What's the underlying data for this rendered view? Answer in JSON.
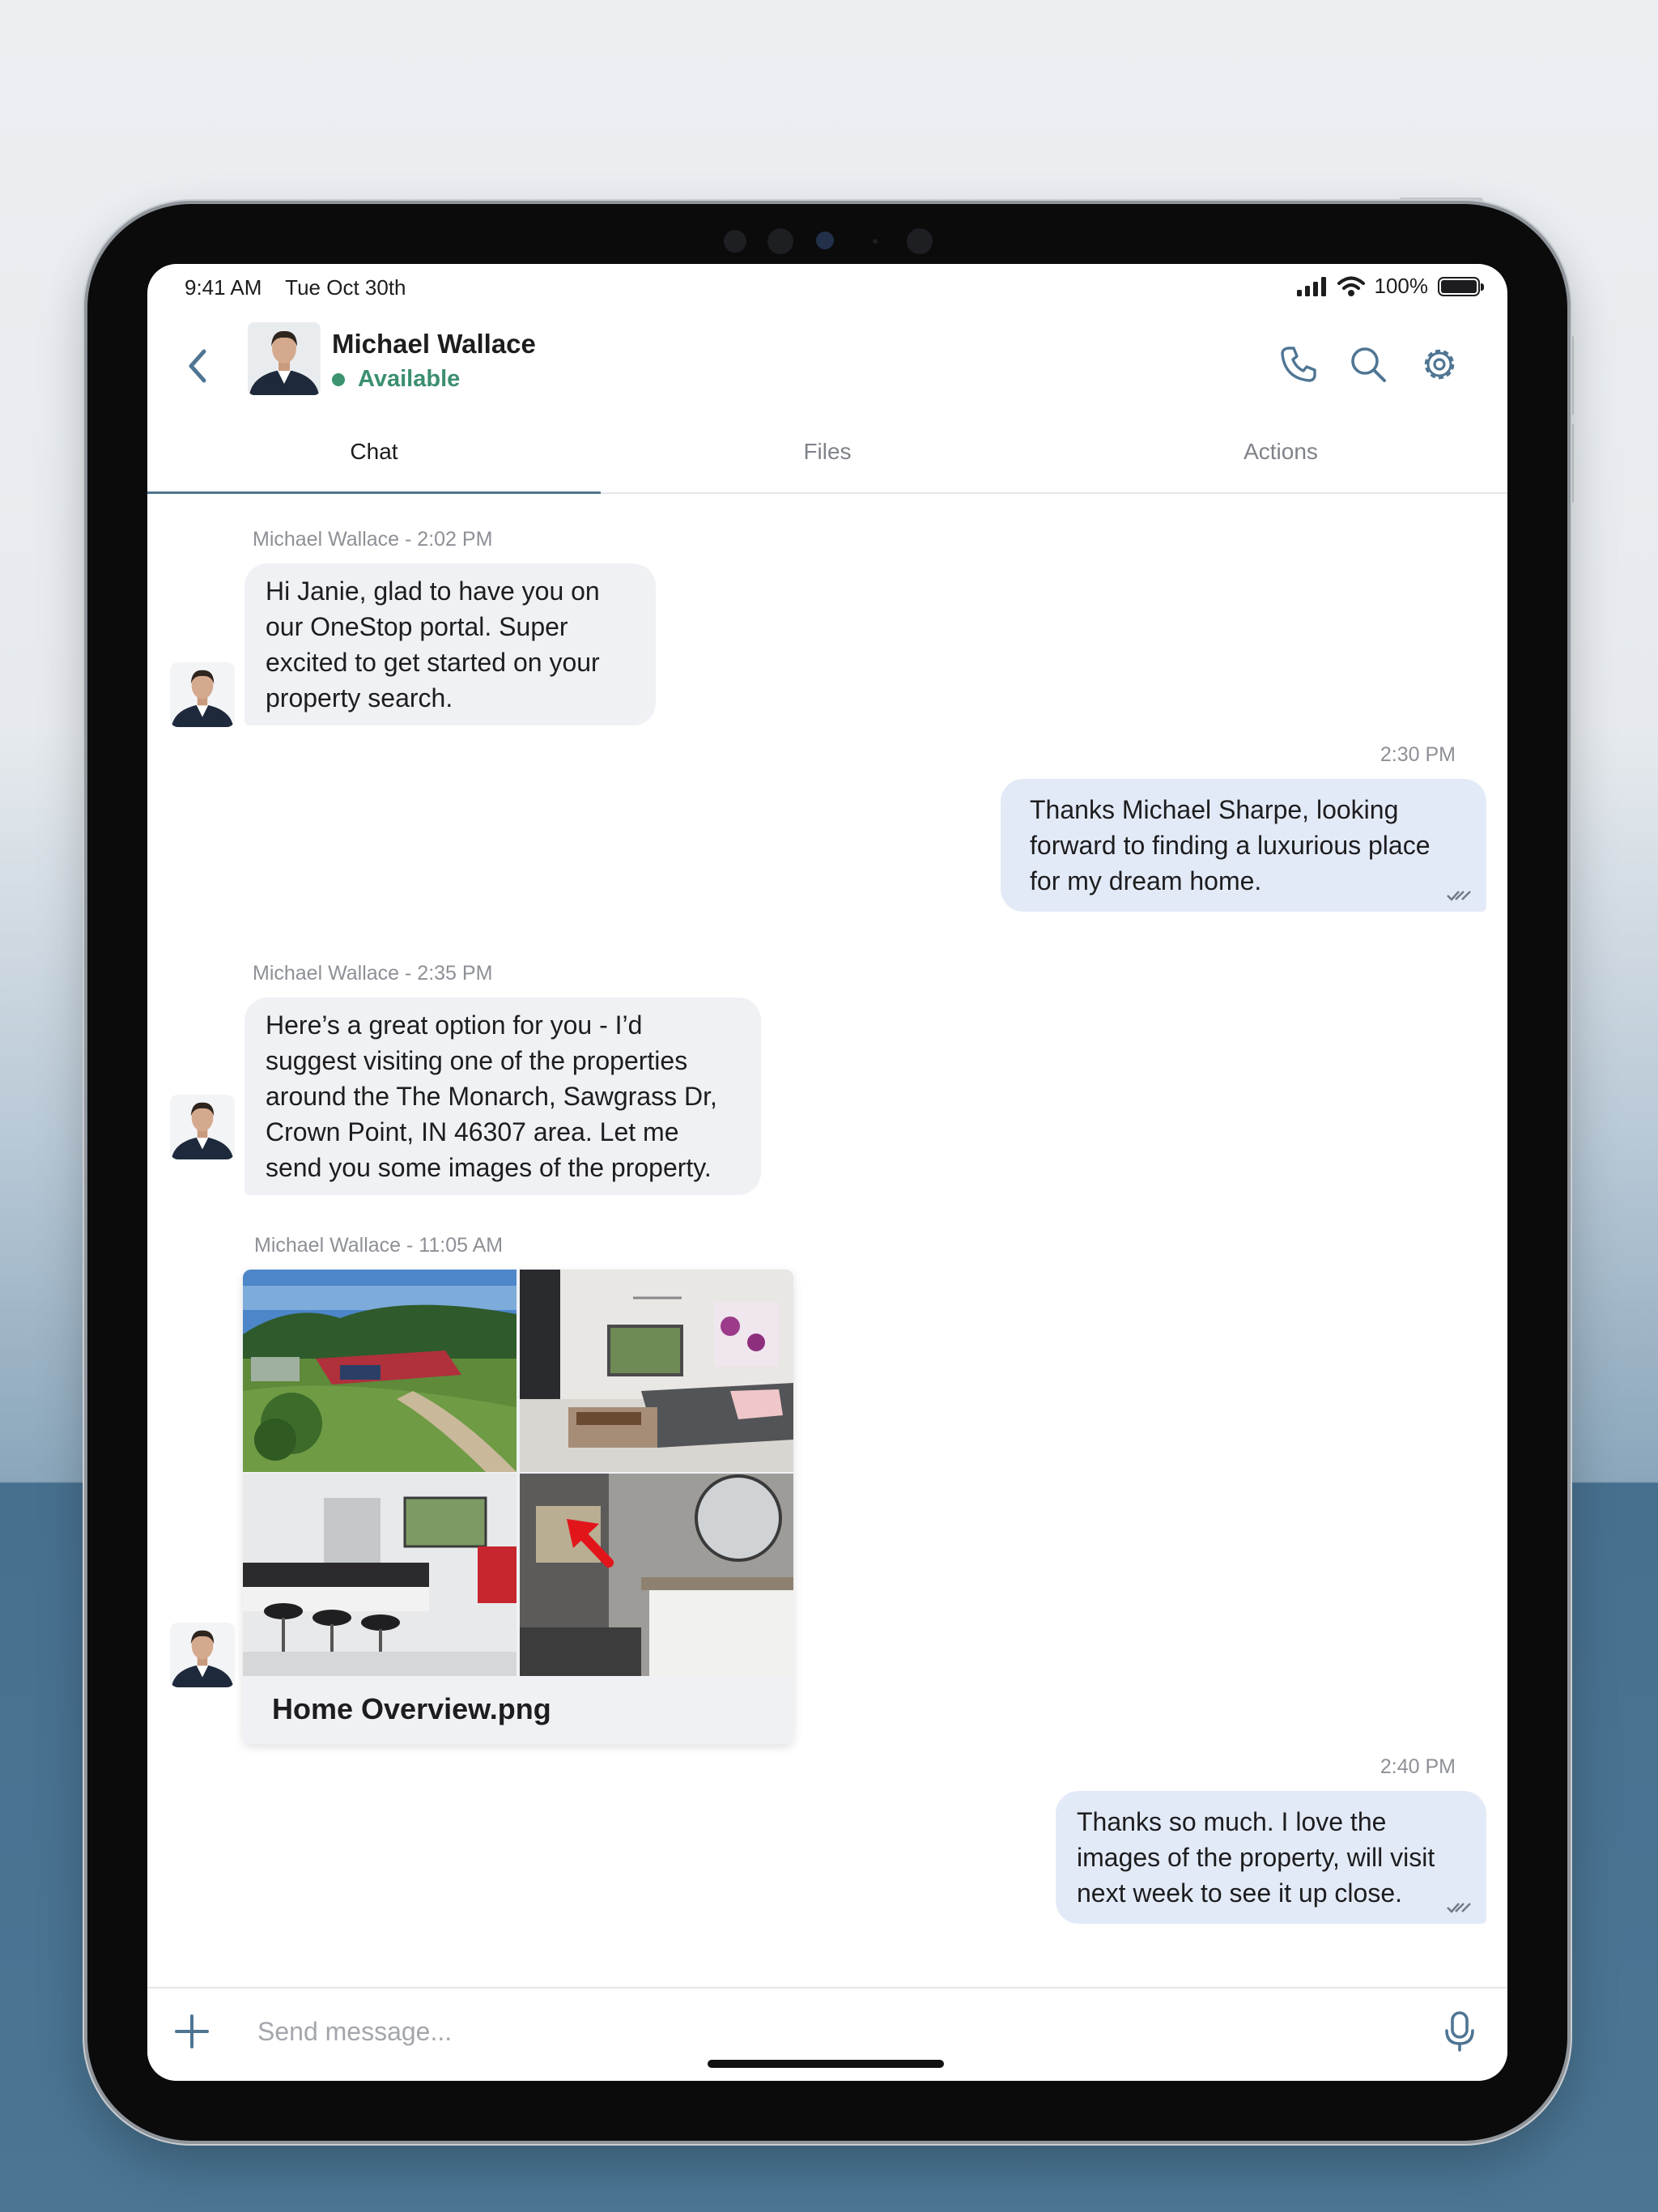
{
  "status_bar": {
    "time": "9:41 AM",
    "date": "Tue Oct 30th",
    "battery": "100%"
  },
  "header": {
    "contact_name": "Michael Wallace",
    "presence": "Available"
  },
  "tabs": [
    {
      "label": "Chat",
      "active": true
    },
    {
      "label": "Files",
      "active": false
    },
    {
      "label": "Actions",
      "active": false
    }
  ],
  "messages": [
    {
      "direction": "incoming",
      "meta": "Michael Wallace - 2:02 PM",
      "text": "Hi Janie, glad to have you on our OneStop portal. Super excited to get started on your property search."
    },
    {
      "direction": "outgoing",
      "meta": "2:30 PM",
      "text": "Thanks Michael Sharpe, looking forward to finding a luxurious place for my dream home."
    },
    {
      "direction": "incoming",
      "meta": "Michael Wallace - 2:35 PM",
      "text": "Here’s a great option for you - I’d suggest visiting one of the properties around the The Monarch, Sawgrass Dr, Crown Point, IN 46307 area. Let me send you some images of the property."
    },
    {
      "direction": "incoming",
      "meta": "Michael Wallace - 11:05 AM",
      "attachment": {
        "file_name": "Home Overview.png"
      }
    },
    {
      "direction": "outgoing",
      "meta": "2:40 PM",
      "text": "Thanks so much. I love the images of the property, will visit next week to see it up close."
    }
  ],
  "composer": {
    "placeholder": "Send message..."
  },
  "colors": {
    "accent": "#51758f",
    "available": "#3b8f6e",
    "incoming_bubble": "#eff1f4",
    "outgoing_bubble": "#e3eaf7"
  }
}
